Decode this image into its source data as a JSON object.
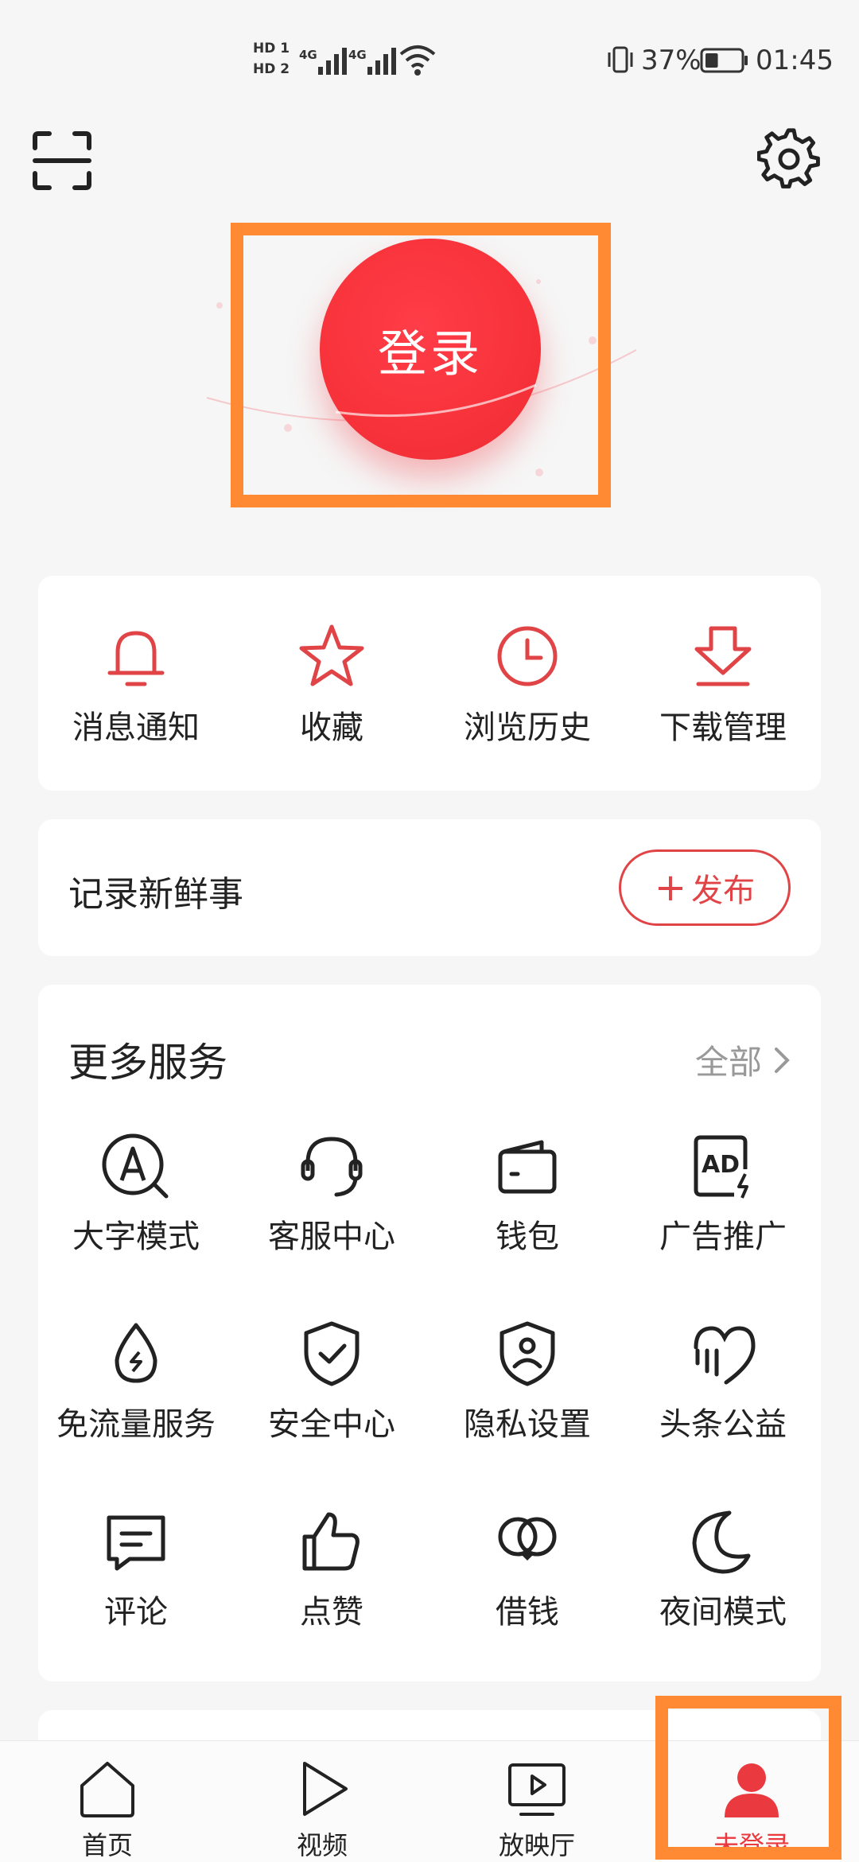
{
  "status": {
    "sim1_label": "HD 1",
    "sim2_label": "HD 2",
    "network1": "4G",
    "network2": "4G",
    "battery_percent": "37%",
    "battery_level": 0.37,
    "time": "01:45"
  },
  "login": {
    "label": "登录"
  },
  "quick_actions": [
    {
      "label": "消息通知",
      "icon": "bell-icon"
    },
    {
      "label": "收藏",
      "icon": "star-icon"
    },
    {
      "label": "浏览历史",
      "icon": "clock-icon"
    },
    {
      "label": "下载管理",
      "icon": "download-icon"
    }
  ],
  "record": {
    "title": "记录新鲜事",
    "publish_label": "发布",
    "publish_plus": "+"
  },
  "services": {
    "title": "更多服务",
    "all_label": "全部",
    "items": [
      {
        "label": "大字模式",
        "icon": "large-text-icon"
      },
      {
        "label": "客服中心",
        "icon": "headset-icon"
      },
      {
        "label": "钱包",
        "icon": "wallet-icon"
      },
      {
        "label": "广告推广",
        "icon": "ad-icon"
      },
      {
        "label": "免流量服务",
        "icon": "data-free-icon"
      },
      {
        "label": "安全中心",
        "icon": "shield-check-icon"
      },
      {
        "label": "隐私设置",
        "icon": "privacy-shield-icon"
      },
      {
        "label": "头条公益",
        "icon": "charity-heart-icon"
      },
      {
        "label": "评论",
        "icon": "comment-icon"
      },
      {
        "label": "点赞",
        "icon": "thumbs-up-icon"
      },
      {
        "label": "借钱",
        "icon": "loan-icon"
      },
      {
        "label": "夜间模式",
        "icon": "moon-icon"
      }
    ]
  },
  "bottom_nav": [
    {
      "label": "首页",
      "icon": "home-icon"
    },
    {
      "label": "视频",
      "icon": "play-icon"
    },
    {
      "label": "放映厅",
      "icon": "tv-play-icon"
    },
    {
      "label": "未登录",
      "icon": "user-icon",
      "active": true
    }
  ],
  "colors": {
    "accent": "#ea3a3f",
    "highlight": "#ff8a33",
    "background": "#f6f6f6"
  }
}
